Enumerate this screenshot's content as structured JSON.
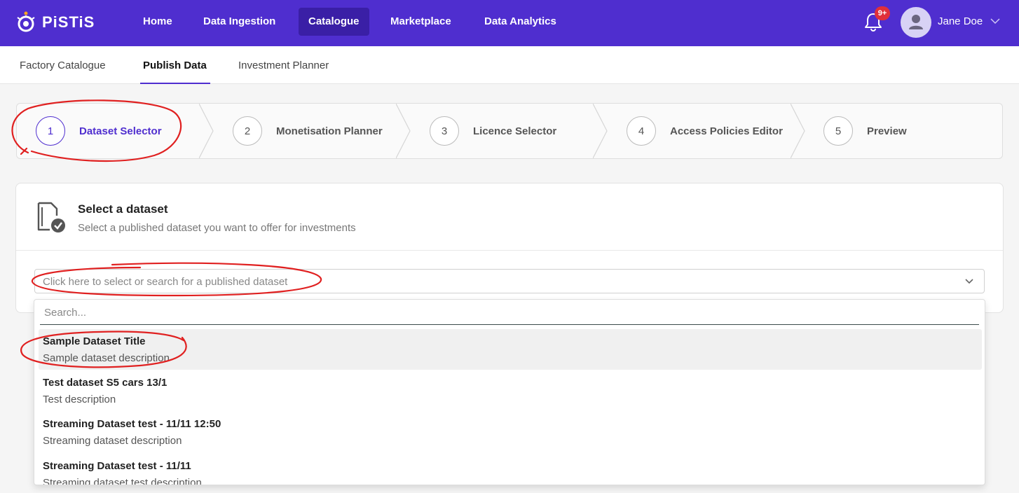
{
  "app": {
    "brand": "PiSTiS"
  },
  "nav": {
    "items": [
      {
        "label": "Home"
      },
      {
        "label": "Data Ingestion"
      },
      {
        "label": "Catalogue",
        "active": true
      },
      {
        "label": "Marketplace"
      },
      {
        "label": "Data Analytics"
      }
    ]
  },
  "user": {
    "name": "Jane Doe",
    "notifications": "9+"
  },
  "subnav": {
    "tabs": [
      {
        "label": "Factory Catalogue"
      },
      {
        "label": "Publish Data",
        "active": true
      },
      {
        "label": "Investment Planner"
      }
    ]
  },
  "stepper": {
    "steps": [
      {
        "number": "1",
        "label": "Dataset Selector",
        "active": true
      },
      {
        "number": "2",
        "label": "Monetisation Planner"
      },
      {
        "number": "3",
        "label": "Licence Selector"
      },
      {
        "number": "4",
        "label": "Access Policies Editor"
      },
      {
        "number": "5",
        "label": "Preview"
      }
    ]
  },
  "card": {
    "title": "Select a dataset",
    "subtitle": "Select a published dataset you want to offer for investments"
  },
  "select": {
    "placeholder": "Click here to select or search for a published dataset",
    "search_placeholder": "Search..."
  },
  "options": [
    {
      "title": "Sample Dataset Title",
      "description": "Sample dataset description"
    },
    {
      "title": "Test dataset S5 cars 13/1",
      "description": "Test description"
    },
    {
      "title": "Streaming Dataset test - 11/11 12:50",
      "description": "Streaming dataset description"
    },
    {
      "title": "Streaming Dataset test - 11/11",
      "description": "Streaming dataset test description"
    }
  ],
  "colors": {
    "brand": "#4f2ecf",
    "nav_active": "#3a1fa6",
    "badge": "#e0303a",
    "annotation": "#e02020"
  },
  "icons": {
    "logo": "pistis-logo-icon",
    "bell": "bell-icon",
    "avatar": "user-avatar-icon",
    "chevron": "chevron-down-icon",
    "card": "document-check-icon"
  }
}
